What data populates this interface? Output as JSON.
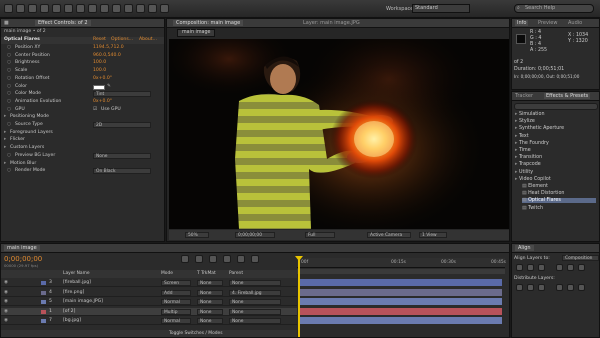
{
  "toolbar": {
    "workspace_label": "Workspace:",
    "workspace_value": "Standard",
    "search_placeholder": "Search Help"
  },
  "effect_controls": {
    "tab_label": "Effect Controls: of 2",
    "subtitle": "main image • of 2",
    "effect_name": "Optical Flares",
    "effect_links": [
      "Reset",
      "Options...",
      "About..."
    ],
    "properties": [
      {
        "label": "Position XY",
        "value": "1194.5,712.0",
        "type": "value"
      },
      {
        "label": "Center Position",
        "value": "960.0,540.0",
        "type": "value"
      },
      {
        "label": "Brightness",
        "value": "100.0",
        "type": "value"
      },
      {
        "label": "Scale",
        "value": "100.0",
        "type": "value"
      },
      {
        "label": "Rotation Offset",
        "value": "0x+0.0°",
        "type": "value"
      },
      {
        "label": "Color",
        "value": "",
        "type": "color"
      },
      {
        "label": "Color Mode",
        "value": "Tint",
        "type": "dropdown"
      },
      {
        "label": "Animation Evolution",
        "value": "0x+0.0°",
        "type": "value"
      },
      {
        "label": "GPU",
        "value": "Use GPU",
        "type": "checkbox"
      },
      {
        "label": "Positioning Mode",
        "value": "",
        "type": "group"
      },
      {
        "label": "Source Type",
        "value": "2D",
        "type": "dropdown"
      },
      {
        "label": "Foreground Layers",
        "value": "",
        "type": "group"
      },
      {
        "label": "Flicker",
        "value": "",
        "type": "group"
      },
      {
        "label": "Custom Layers",
        "value": "",
        "type": "group"
      },
      {
        "label": "Preview BG Layer",
        "value": "None",
        "type": "dropdown"
      },
      {
        "label": "Motion Blur",
        "value": "",
        "type": "group"
      },
      {
        "label": "Render Mode",
        "value": "On Black",
        "type": "dropdown"
      }
    ]
  },
  "composition": {
    "tab_label": "Composition: main image",
    "layer_tab_label": "Layer: main image.JPG",
    "comp_tab": "main image",
    "footer": {
      "zoom": "50%",
      "timecode": "0;00;00;00",
      "resolution": "Full",
      "camera": "Active Camera",
      "views": "1 View"
    }
  },
  "info": {
    "tabs": [
      "Info",
      "Preview",
      "Audio"
    ],
    "r_label": "R : 4",
    "g_label": "G : 4",
    "b_label": "B : 4",
    "a_label": "A : 255",
    "x_label": "X : 1034",
    "y_label": "Y : 1320",
    "layer_name": "of 2",
    "duration": "Duration: 0;00;51;01",
    "in_label": "In: 0;00;00;00, Out: 0;00;51;00"
  },
  "effects_presets": {
    "tabs": [
      "Tracker",
      "Effects & Presets"
    ],
    "categories": [
      "Simulation",
      "Stylize",
      "Synthetic Aperture",
      "Text",
      "The Foundry",
      "Time",
      "Transition",
      "Trapcode",
      "Utility",
      "Video Copilot"
    ],
    "subitems": [
      "Element",
      "Heat Distortion",
      "Optical Flares",
      "Twitch"
    ],
    "selected": "Optical Flares"
  },
  "timeline": {
    "tab_label": "main image",
    "timecode": "0;00;00;00",
    "fps_label": "00000 (29.97 fps)",
    "columns": [
      "Layer Name",
      "Mode",
      "T TrkMat",
      "Parent"
    ],
    "layers": [
      {
        "num": "3",
        "name": "[fireball.jpg]",
        "mode": "Screen",
        "trkmat": "None",
        "parent": "None",
        "color": "#5a6aa8"
      },
      {
        "num": "4",
        "name": "[fire.png]",
        "mode": "Add",
        "trkmat": "None",
        "parent": "4. Fireball.jpg",
        "color": "#6b6b8c"
      },
      {
        "num": "5",
        "name": "[main image.JPG]",
        "mode": "Normal",
        "trkmat": "None",
        "parent": "None",
        "color": "#6b7bb0"
      },
      {
        "num": "1",
        "name": "[of 2]",
        "mode": "Multip",
        "trkmat": "None",
        "parent": "None",
        "color": "#b8525a"
      },
      {
        "num": "7",
        "name": "[bg.jpg]",
        "mode": "Normal",
        "trkmat": "None",
        "parent": "None",
        "color": "#6b7bb0"
      }
    ],
    "ruler_marks": [
      "00f",
      "00:15s",
      "00:30s",
      "00:45s"
    ],
    "footer": "Toggle Switches / Modes"
  },
  "align": {
    "tab_label": "Align",
    "align_to_label": "Align Layers to:",
    "align_to_value": "Composition",
    "distribute_label": "Distribute Layers:"
  },
  "colors": {
    "accent_orange": "#e08a30",
    "timeline_red": "#b8525a",
    "timeline_blue": "#6b7bb0",
    "cti_yellow": "#e8c400"
  }
}
